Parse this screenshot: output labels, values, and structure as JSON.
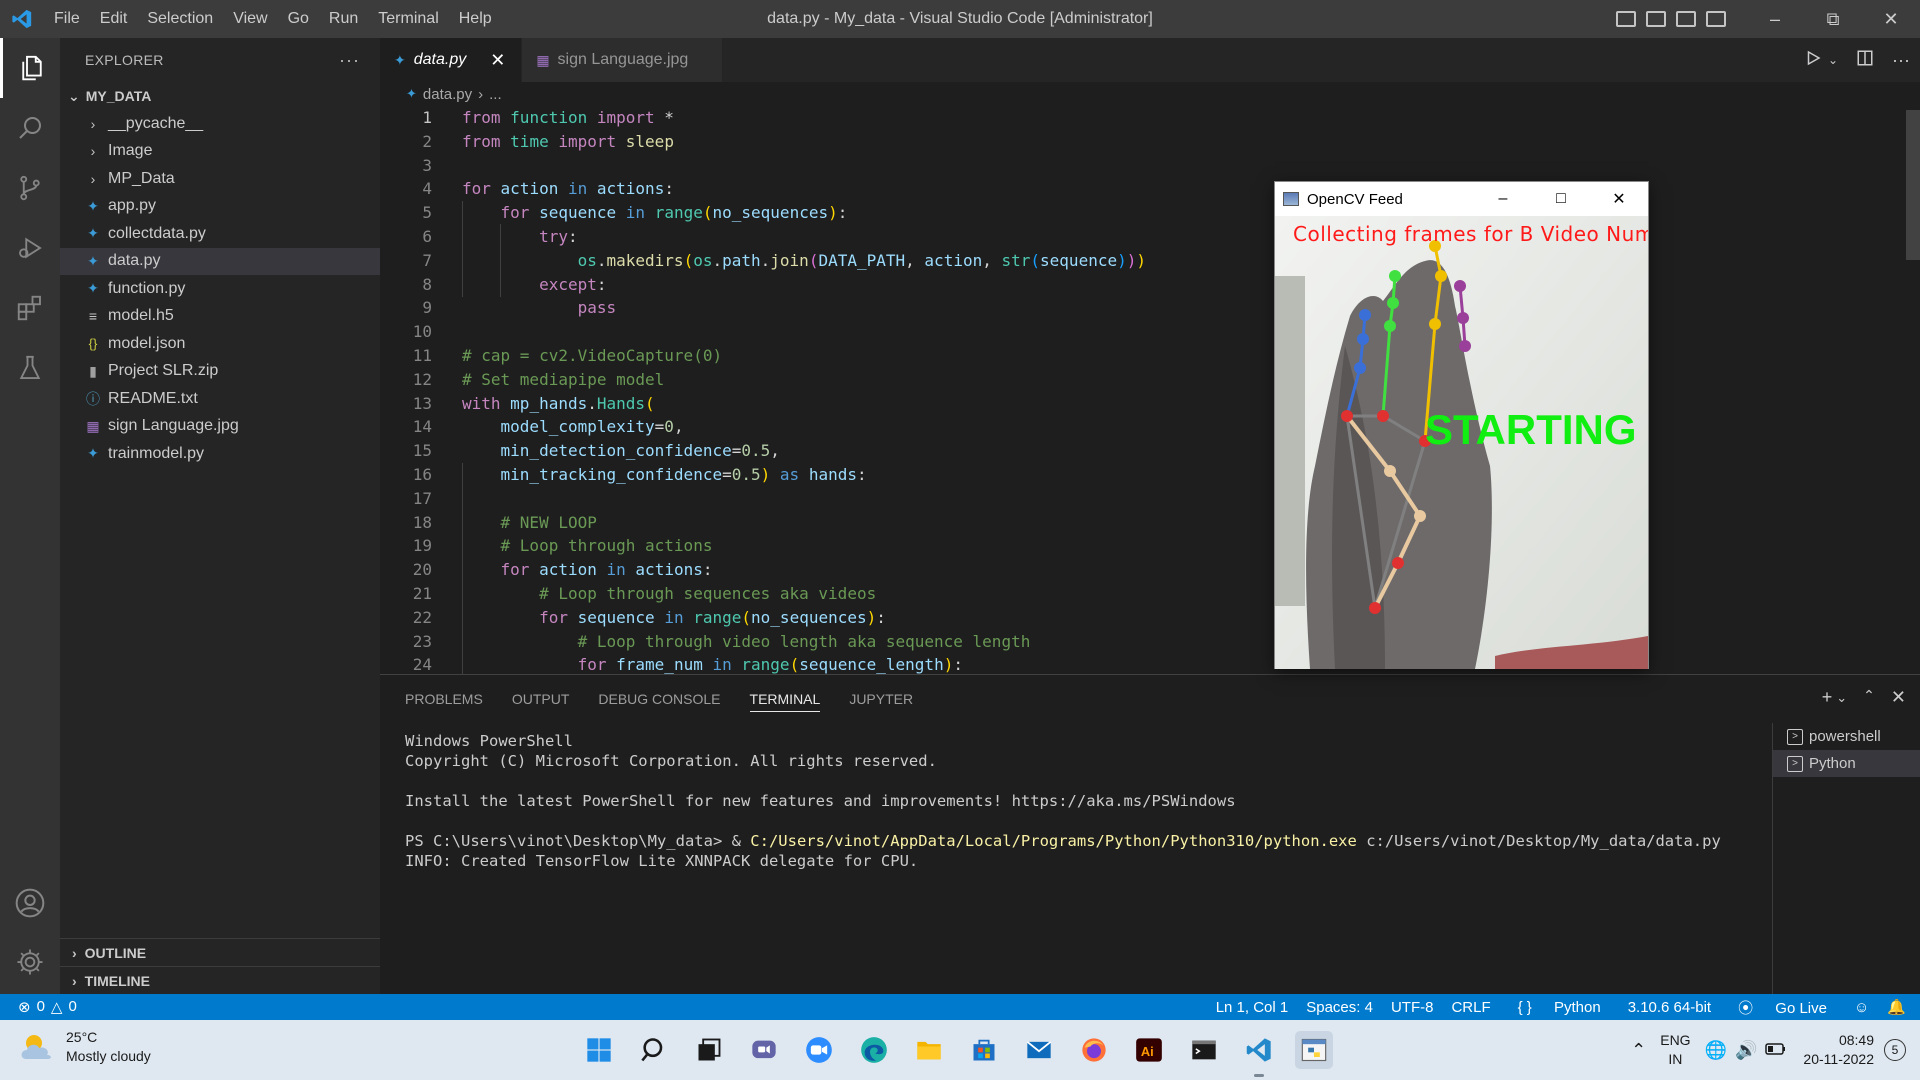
{
  "titlebar": {
    "menu": [
      "File",
      "Edit",
      "Selection",
      "View",
      "Go",
      "Run",
      "Terminal",
      "Help"
    ],
    "title": "data.py - My_data - Visual Studio Code [Administrator]"
  },
  "sidebar": {
    "header": "EXPLORER",
    "more": "···",
    "root": "MY_DATA",
    "items": [
      {
        "label": "__pycache__",
        "type": "folder"
      },
      {
        "label": "Image",
        "type": "folder"
      },
      {
        "label": "MP_Data",
        "type": "folder"
      },
      {
        "label": "app.py",
        "type": "python"
      },
      {
        "label": "collectdata.py",
        "type": "python"
      },
      {
        "label": "data.py",
        "type": "python"
      },
      {
        "label": "function.py",
        "type": "python"
      },
      {
        "label": "model.h5",
        "type": "text"
      },
      {
        "label": "model.json",
        "type": "json"
      },
      {
        "label": "Project SLR.zip",
        "type": "zip"
      },
      {
        "label": "README.txt",
        "type": "info"
      },
      {
        "label": "sign Language.jpg",
        "type": "image"
      },
      {
        "label": "trainmodel.py",
        "type": "python"
      }
    ],
    "outline": "OUTLINE",
    "timeline": "TIMELINE"
  },
  "tabs": [
    {
      "label": "data.py"
    },
    {
      "label": "sign Language.jpg"
    }
  ],
  "breadcrumb": {
    "file": "data.py",
    "rest": "..."
  },
  "code_lines": [
    "1",
    "2",
    "3",
    "4",
    "5",
    "6",
    "7",
    "8",
    "9",
    "10",
    "11",
    "12",
    "13",
    "14",
    "15",
    "16",
    "17",
    "18",
    "19",
    "20",
    "21",
    "22",
    "23",
    "24"
  ],
  "panel": {
    "tabs": [
      "PROBLEMS",
      "OUTPUT",
      "DEBUG CONSOLE",
      "TERMINAL",
      "JUPYTER"
    ],
    "terminal": {
      "l1": "Windows PowerShell",
      "l2": "Copyright (C) Microsoft Corporation. All rights reserved.",
      "l3": "Install the latest PowerShell for new features and improvements! https://aka.ms/PSWindows",
      "prompt": "PS C:\\Users\\vinot\\Desktop\\My_data> & ",
      "exe": "C:/Users/vinot/AppData/Local/Programs/Python/Python310/python.exe",
      "arg": " c:/Users/vinot/Desktop/My_data/data.py",
      "l5": "INFO: Created TensorFlow Lite XNNPACK delegate for CPU."
    },
    "terminals": [
      "powershell",
      "Python"
    ]
  },
  "statusbar": {
    "errors": "0",
    "warnings": "0",
    "position": "Ln 1, Col 1",
    "spaces": "Spaces: 4",
    "encoding": "UTF-8",
    "eol": "CRLF",
    "language": "Python",
    "interpreter": "3.10.6 64-bit",
    "golive": "Go Live"
  },
  "cvwindow": {
    "title": "OpenCV Feed",
    "caption": "Collecting frames for B Video Numb",
    "overlay": "STARTING C"
  },
  "taskbar": {
    "temp": "25°C",
    "weather": "Mostly cloudy",
    "lang1": "ENG",
    "lang2": "IN",
    "time": "08:49",
    "date": "20-11-2022",
    "notifications": "5"
  },
  "colors": {
    "accent": "#007acc",
    "activity_bar": "#333333",
    "sidebar": "#252526",
    "editor": "#1e1e1e"
  }
}
